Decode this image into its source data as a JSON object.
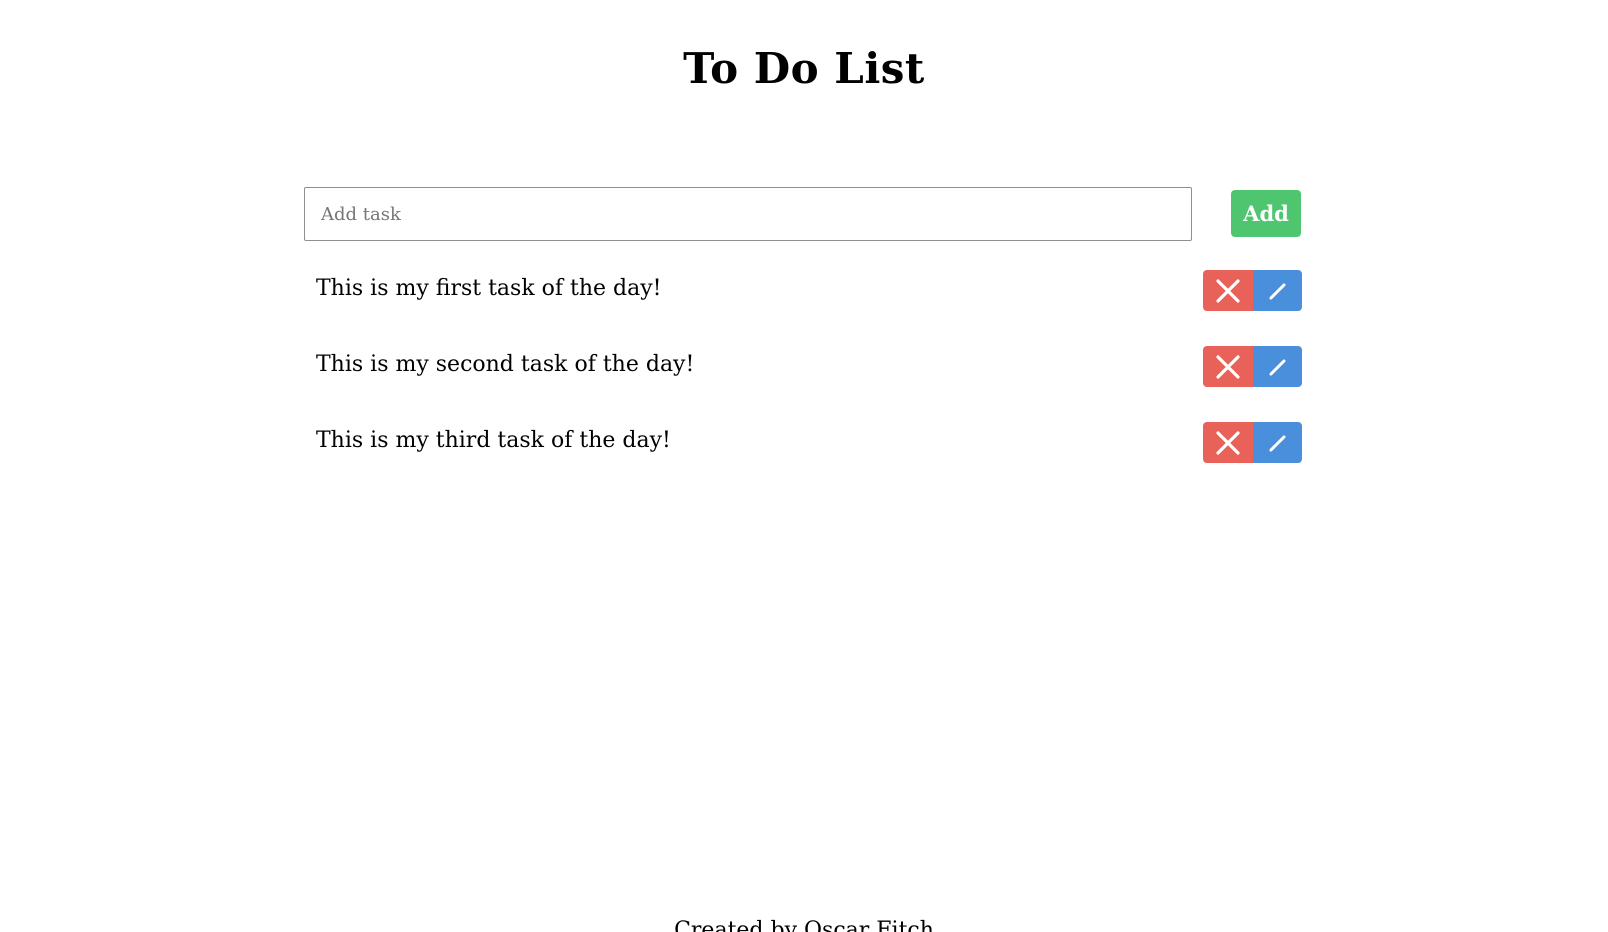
{
  "app": {
    "title": "To Do List"
  },
  "add_form": {
    "input_value": "",
    "input_placeholder": "Add task",
    "add_label": "Add"
  },
  "tasks": [
    {
      "text": "This is my first task of the day!",
      "delete_icon": "close-icon",
      "edit_icon": "pencil-icon"
    },
    {
      "text": "This is my second task of the day!",
      "delete_icon": "close-icon",
      "edit_icon": "pencil-icon"
    },
    {
      "text": "This is my third task of the day!",
      "delete_icon": "close-icon",
      "edit_icon": "pencil-icon"
    }
  ],
  "footer": {
    "credit": "Created by Oscar Fitch"
  },
  "colors": {
    "add_button": "#4fc56f",
    "delete_button": "#e8625a",
    "edit_button": "#4a8fdb",
    "text": "#000000",
    "background": "#ffffff"
  }
}
